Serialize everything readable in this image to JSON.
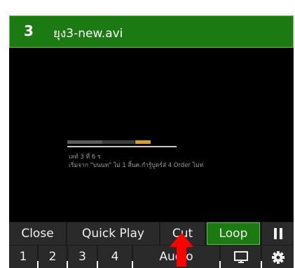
{
  "header": {
    "number": "3",
    "filename": "ยุง3-new.avi",
    "color": "#1c7a12",
    "border_color": "#62c151"
  },
  "preview": {
    "line1": "เลท์ 3 ที่ 6 ร",
    "line2": "เริ่มจาก \"บนนท\" ไม่ 1 สิ้นค.กำรู้บู่ตร์ล๋ 4 Order ไม่ท่"
  },
  "controls": {
    "close": "Close",
    "quick_play": "Quick Play",
    "cut": "Cut",
    "loop": "Loop",
    "pause_icon": "pause-icon",
    "n1": "1",
    "n2": "2",
    "n3": "3",
    "n4": "4",
    "audio": "Audio",
    "monitor_icon": "monitor-icon",
    "settings_icon": "gear-icon",
    "active_color": "#1c7a12"
  },
  "annotation": {
    "arrow_icon": "red-arrow-icon",
    "arrow_color": "#ff0000"
  }
}
